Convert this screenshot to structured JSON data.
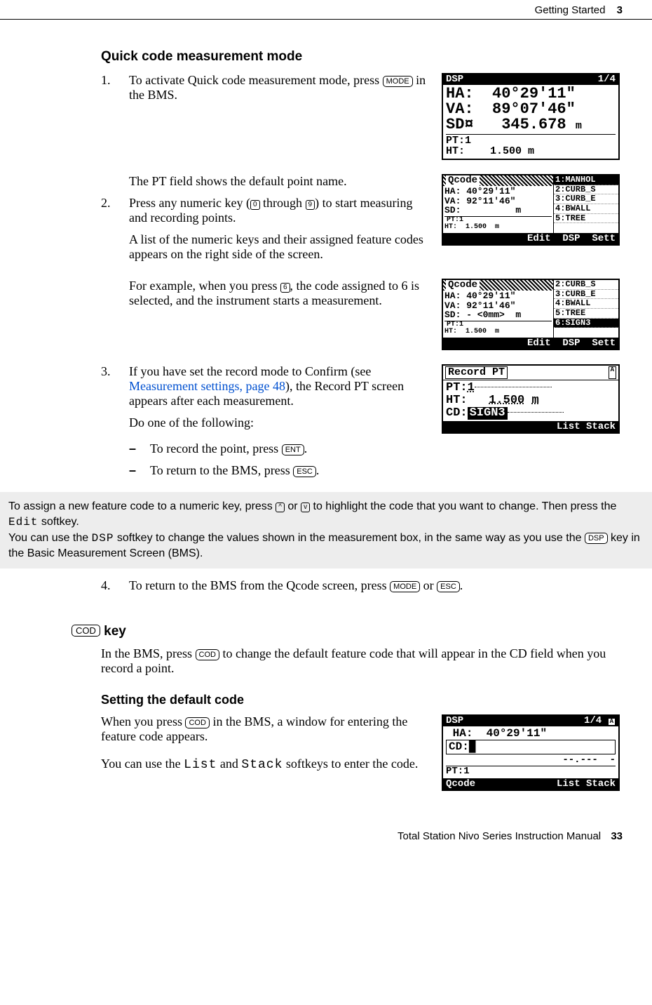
{
  "header": {
    "section": "Getting Started",
    "chapter": "3"
  },
  "h_quick": "Quick code measurement mode",
  "step1": {
    "num": "1.",
    "text_a": "To activate Quick code measurement mode, press ",
    "key": "MODE",
    "text_b": " in the BMS."
  },
  "lcd1": {
    "title_left": "DSP",
    "title_right": "1/4",
    "ha_label": "HA:",
    "ha_val": "40°29'11\"",
    "va_label": "VA:",
    "va_val": "89°07'46\"",
    "sd_label": "SD¤",
    "sd_val": "345.678",
    "sd_unit": "m",
    "pt": "PT:1",
    "ht_label": "HT:",
    "ht_val": "1.500 m"
  },
  "pt_field_para": "The PT field shows the default point name.",
  "step2": {
    "num": "2.",
    "text_a": "Press any numeric key (",
    "key0": "0",
    "text_b": " through ",
    "key9": "9",
    "text_c": ") to start measuring and recording points."
  },
  "list_para": "A list of the numeric keys and their assigned feature codes appears on the right side of the screen.",
  "example_para_a": "For example, when you press ",
  "example_key": "6",
  "example_para_b": ", the code assigned to 6 is selected, and the instrument starts a measurement.",
  "lcd2": {
    "title": "Qcode",
    "ha": "HA: 40°29'11\"",
    "va": "VA: 92°11'46\"",
    "sd": "SD:          m",
    "pt": "PT:1",
    "ht": "HT:  1.500  m",
    "menu": [
      "1:MANHOL",
      "2:CURB_S",
      "3:CURB_E",
      "4:BWALL",
      "5:TREE"
    ],
    "sel_idx": 0,
    "soft": "Edit  DSP  Sett"
  },
  "lcd3": {
    "title": "Qcode",
    "ha": "HA: 40°29'11\"",
    "va": "VA: 92°11'46\"",
    "sd": "SD: - <0mm>  m",
    "pt": "PT:1",
    "ht": "HT:  1.500  m",
    "menu": [
      "2:CURB_S",
      "3:CURB_E",
      "4:BWALL",
      "5:TREE",
      "6:SIGN3"
    ],
    "sel_idx": 4,
    "soft": "Edit  DSP  Sett"
  },
  "step3": {
    "num": "3.",
    "text_a": "If you have set the record mode to Confirm (see ",
    "link": "Measurement settings, page 48",
    "text_b": "), the Record PT screen appears after each measurement."
  },
  "do_one": "Do one of the following:",
  "dash1_a": "To record the point, press ",
  "dash1_key": "ENT",
  "dash1_b": ".",
  "dash2_a": "To return to the BMS, press ",
  "dash2_key": "ESC",
  "dash2_b": ".",
  "lcd4": {
    "title": "Record PT",
    "a_ind": "A",
    "pt_label": "PT:",
    "pt_val": "1",
    "ht_label": "HT:",
    "ht_val": "1.500",
    "ht_unit": "m",
    "cd_label": "CD:",
    "cd_val": "SIGN3",
    "soft": "List Stack"
  },
  "note": {
    "line1_a": "To assign a new feature code to a numeric key, press ",
    "key_up": "^",
    "line1_b": " or ",
    "key_dn": "v",
    "line1_c": " to highlight the code that you want to change. Then press the ",
    "edit": "Edit",
    "line1_d": " softkey.",
    "line2_a": "You can use the ",
    "dsp": "DSP",
    "line2_b": " softkey to change the values shown in the measurement box, in the same way as you use the ",
    "dsp_key": "DSP",
    "line2_c": " key in the Basic Measurement Screen (BMS)."
  },
  "step4": {
    "num": "4.",
    "text_a": "To return to the BMS from the Qcode screen, press ",
    "key1": "MODE",
    "text_b": " or ",
    "key2": "ESC",
    "text_c": "."
  },
  "h_cod": {
    "key": "COD",
    "word": " key"
  },
  "cod_para_a": "In the BMS, press ",
  "cod_key": "COD",
  "cod_para_b": " to change the default feature code that will appear in the CD field when you record a point.",
  "h_setting": "Setting the default code",
  "setting_p1_a": "When you press ",
  "setting_key": "COD",
  "setting_p1_b": " in the BMS, a window for entering the feature code appears.",
  "setting_p2_a": "You can use the ",
  "list_sk": "List",
  "setting_p2_b": " and ",
  "stack_sk": "Stack",
  "setting_p2_c": " softkeys to enter the code.",
  "lcd5": {
    "title_left": "DSP",
    "title_right": "1/4",
    "a_ind": "A",
    "ha_label": "HA:",
    "ha_val": "40°29'11\"",
    "cd_label": "CD:",
    "cursor": "█",
    "sd_dash": "--.---  -",
    "pt": "PT:1",
    "soft_left": "Qcode",
    "soft_right": "List Stack"
  },
  "footer": {
    "manual": "Total Station Nivo Series Instruction Manual",
    "page": "33"
  }
}
